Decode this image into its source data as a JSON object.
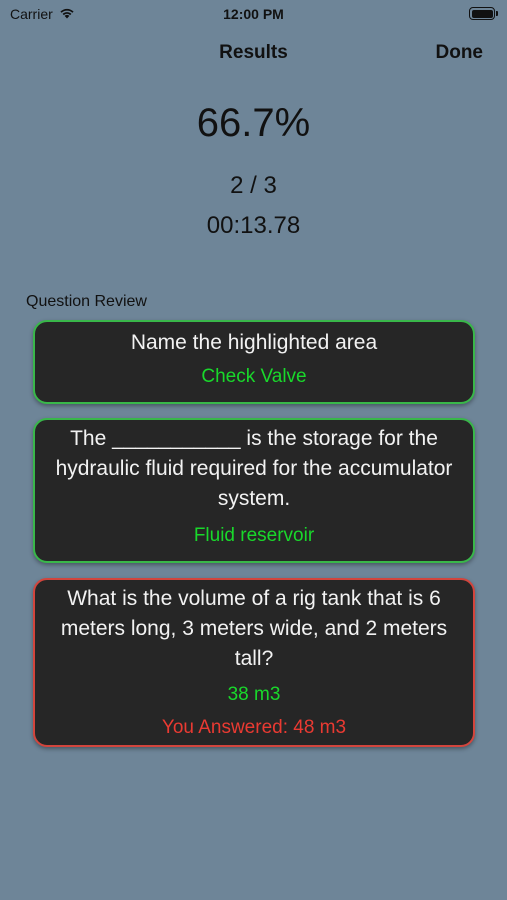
{
  "status_bar": {
    "carrier": "Carrier",
    "time": "12:00 PM",
    "wifi_icon": "wifi-icon",
    "battery_icon": "battery-icon"
  },
  "nav": {
    "title": "Results",
    "done_label": "Done"
  },
  "summary": {
    "percentage": "66.7%",
    "score": "2 / 3",
    "elapsed": "00:13.78"
  },
  "review": {
    "heading": "Question Review",
    "items": [
      {
        "question": "Name the highlighted area",
        "answer": "Check Valve",
        "status": "correct"
      },
      {
        "question": "The ___________ is the storage for the hydraulic fluid required for the accumulator system.",
        "answer": "Fluid reservoir",
        "status": "correct"
      },
      {
        "question": "What is the volume of a rig tank that is 6 meters long, 3 meters wide, and 2 meters tall?",
        "answer": "38 m3",
        "user_answer": "You Answered: 48 m3",
        "status": "wrong"
      }
    ]
  },
  "colors": {
    "background": "#6e8598",
    "card": "#262626",
    "correct_border": "#39b74a",
    "wrong_border": "#d2453d",
    "answer_text": "#19d82b",
    "user_answer_text": "#ea3a32"
  }
}
